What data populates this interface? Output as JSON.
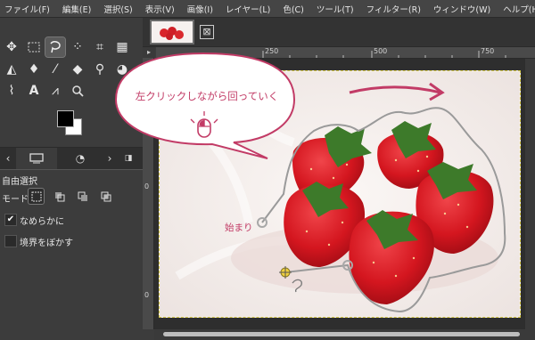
{
  "menu": [
    "ファイル(F)",
    "編集(E)",
    "選択(S)",
    "表示(V)",
    "画像(I)",
    "レイヤー(L)",
    "色(C)",
    "ツール(T)",
    "フィルター(R)",
    "ウィンドウ(W)",
    "ヘルプ(H)"
  ],
  "tool_options": {
    "title": "自由選択",
    "mode_label": "モード:",
    "antialias_label": "なめらかに",
    "antialias_checked": "✔",
    "feather_label": "境界をぼかす"
  },
  "ruler": {
    "h_labels": [
      "250",
      "500",
      "750"
    ],
    "v_labels": [
      "0",
      "0"
    ]
  },
  "annotation": {
    "bubble_text": "左クリックしながら回っていく",
    "start_label": "始まり",
    "accent_color": "#c23b66"
  },
  "image_tab": {
    "close_symbol": "⊠"
  },
  "colors": {
    "fg": "#000000",
    "bg": "#ffffff"
  }
}
